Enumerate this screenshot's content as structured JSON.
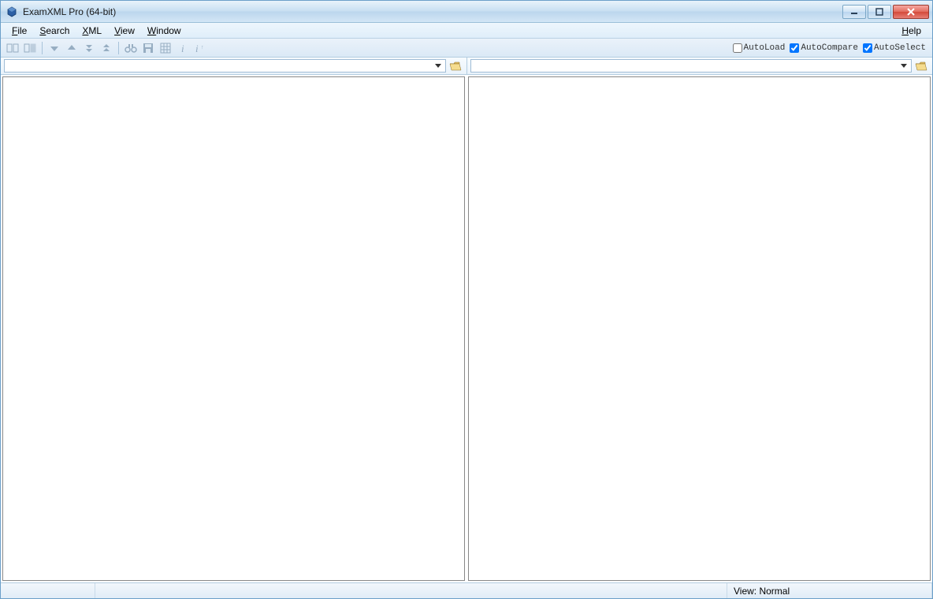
{
  "titlebar": {
    "title": "ExamXML Pro (64-bit)"
  },
  "menubar": {
    "items": [
      {
        "label": "File",
        "ul_index": 0
      },
      {
        "label": "Search",
        "ul_index": 0
      },
      {
        "label": "XML",
        "ul_index": 0
      },
      {
        "label": "View",
        "ul_index": 0
      },
      {
        "label": "Window",
        "ul_index": 0
      }
    ],
    "help": {
      "label": "Help",
      "ul_index": 0
    }
  },
  "toolbar": {
    "buttons": [
      "compare-icon",
      "compare-alt-icon",
      "separator",
      "down-arrow-icon",
      "up-arrow-icon",
      "double-down-icon",
      "double-up-icon",
      "separator",
      "binoculars-icon",
      "save-icon",
      "grid-icon",
      "info-icon",
      "info-alt-icon"
    ]
  },
  "options": {
    "autoload": {
      "label": "AutoLoad",
      "checked": false
    },
    "autocompare": {
      "label": "AutoCompare",
      "checked": true
    },
    "autoselect": {
      "label": "AutoSelect",
      "checked": true
    }
  },
  "filebar": {
    "left": {
      "value": ""
    },
    "right": {
      "value": ""
    }
  },
  "statusbar": {
    "view_label": "View: Normal"
  }
}
